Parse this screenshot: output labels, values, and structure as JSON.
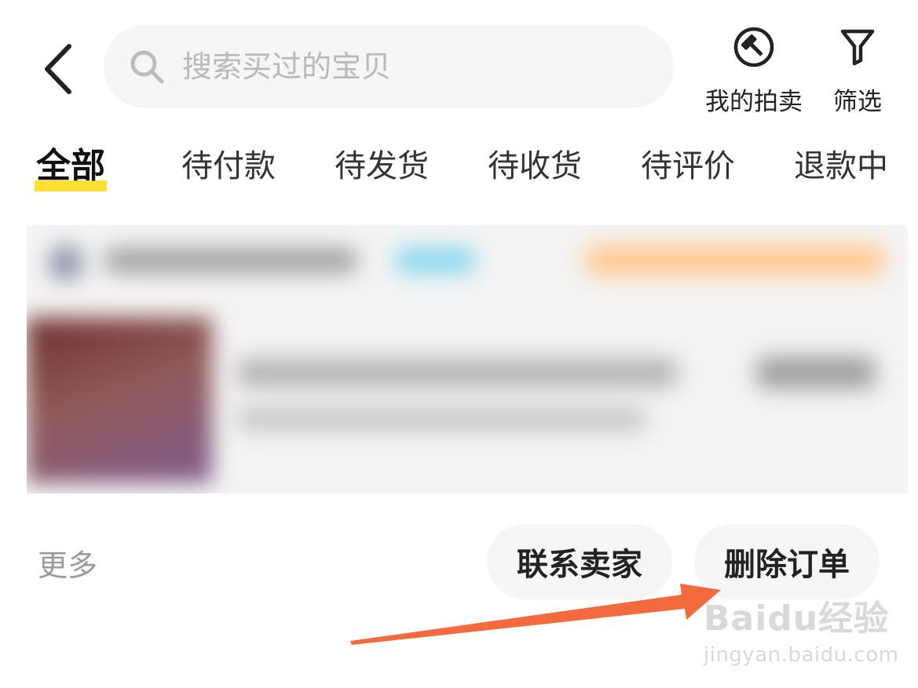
{
  "header": {
    "search": {
      "placeholder": "搜索买过的宝贝",
      "value": ""
    },
    "actions": {
      "auction_label": "我的拍卖",
      "filter_label": "筛选"
    }
  },
  "tabs": [
    {
      "label": "全部",
      "active": true
    },
    {
      "label": "待付款",
      "active": false
    },
    {
      "label": "待发货",
      "active": false
    },
    {
      "label": "待收货",
      "active": false
    },
    {
      "label": "待评价",
      "active": false
    },
    {
      "label": "退款中",
      "active": false
    }
  ],
  "order": {
    "more_label": "更多",
    "contact_label": "联系卖家",
    "delete_label": "删除订单"
  },
  "watermark": {
    "logo": "Baidu经验",
    "url": "jingyan.baidu.com"
  },
  "colors": {
    "accent_yellow": "#ffe033",
    "arrow_orange": "#f26a3d",
    "pill_bg": "#f6f6f6"
  }
}
